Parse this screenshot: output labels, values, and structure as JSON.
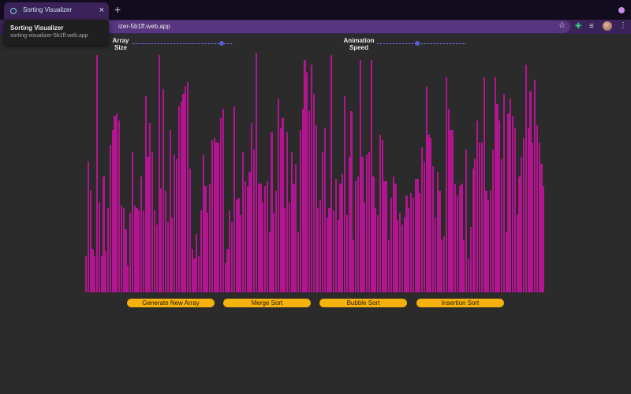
{
  "browser": {
    "tab_title": "Sorting Visualizer",
    "tab_close": "×",
    "new_tab": "+",
    "url": "izer-5b1ff.web.app",
    "star": "☆",
    "menu": "⋮",
    "tooltip_title": "Sorting Visualizer",
    "tooltip_url": "sorting-visualizer-5b1ff.web.app",
    "icons": [
      "puzzle-icon",
      "reading-list-icon",
      "avatar-icon"
    ]
  },
  "controls": {
    "array_size_label": "Array Size",
    "array_size_value": 0.88,
    "speed_label": "Animation Speed",
    "speed_value": 0.45
  },
  "array": {
    "bar_color": "#b3148f",
    "max_value": 100,
    "values": [
      15,
      54,
      42,
      18,
      15,
      98,
      37,
      15,
      48,
      17,
      35,
      61,
      67,
      73,
      74,
      71,
      36,
      35,
      26,
      11,
      33,
      58,
      36,
      35,
      34,
      48,
      34,
      81,
      56,
      70,
      58,
      34,
      28,
      98,
      43,
      84,
      42,
      29,
      67,
      31,
      57,
      55,
      77,
      79,
      82,
      85,
      87,
      51,
      18,
      14,
      24,
      15,
      34,
      57,
      44,
      33,
      45,
      63,
      64,
      62,
      62,
      72,
      76,
      12,
      18,
      34,
      29,
      77,
      38,
      39,
      32,
      58,
      46,
      44,
      50,
      70,
      59,
      99,
      45,
      45,
      37,
      44,
      46,
      25,
      66,
      33,
      42,
      80,
      68,
      72,
      35,
      66,
      37,
      58,
      45,
      53,
      25,
      67,
      76,
      96,
      91,
      75,
      94,
      82,
      69,
      35,
      38,
      58,
      68,
      31,
      35,
      98,
      34,
      47,
      30,
      45,
      49,
      81,
      32,
      56,
      75,
      22,
      46,
      48,
      96,
      56,
      37,
      57,
      58,
      96,
      48,
      35,
      32,
      65,
      63,
      46,
      46,
      22,
      39,
      48,
      45,
      30,
      33,
      28,
      31,
      40,
      35,
      41,
      39,
      47,
      47,
      41,
      60,
      54,
      85,
      65,
      64,
      52,
      31,
      50,
      42,
      22,
      23,
      89,
      76,
      67,
      67,
      45,
      40,
      44,
      45,
      22,
      59,
      14,
      27,
      51,
      55,
      71,
      62,
      62,
      89,
      42,
      38,
      42,
      59,
      89,
      78,
      71,
      55,
      82,
      25,
      74,
      80,
      73,
      68,
      32,
      48,
      56,
      64,
      94,
      68,
      83,
      62,
      88,
      69,
      62,
      53,
      44
    ],
    "bar_heights_note": ""
  },
  "buttons": {
    "generate": "Generate New Array",
    "merge": "Merge Sort",
    "bubble": "Bubble Sort",
    "insertion": "Insertion Sort"
  },
  "colors": {
    "bar": "#b3148f",
    "button": "#f4b20a",
    "background": "#2b2b2b",
    "tabstrip": "#130c1e",
    "toolbar": "#3a2358"
  }
}
